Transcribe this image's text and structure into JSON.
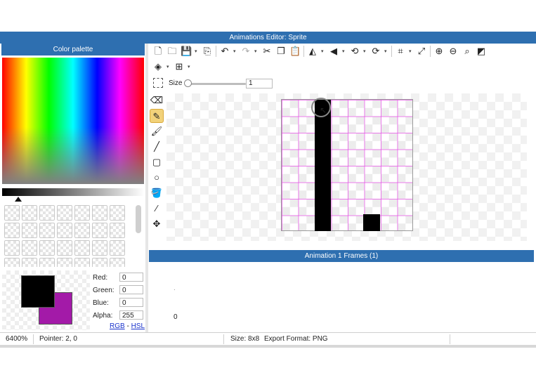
{
  "window": {
    "title": "Animations Editor: Sprite"
  },
  "palette": {
    "header": "Color palette",
    "foreground": "#000000",
    "background": "#a31aa8",
    "fields": [
      {
        "label": "Red:",
        "value": "0"
      },
      {
        "label": "Green:",
        "value": "0"
      },
      {
        "label": "Blue:",
        "value": "0"
      },
      {
        "label": "Alpha:",
        "value": "255"
      }
    ],
    "mode_rgb": "RGB",
    "mode_sep": "-",
    "mode_hsl": "HSL"
  },
  "toolbar": {
    "row1_icons": [
      "new-file",
      "open-folder",
      "save",
      "save-dropdown",
      "export",
      "undo",
      "undo-dropdown",
      "redo",
      "redo-dropdown",
      "cut",
      "copy",
      "paste",
      "flip-horizontal",
      "flip-dropdown",
      "flip-vertical",
      "flip-v-dropdown",
      "rotate-left",
      "rotate-left-dropdown",
      "rotate-right",
      "rotate-right-dropdown",
      "crop",
      "crop-dropdown",
      "resize",
      "zoom-in",
      "zoom-out",
      "zoom-fit",
      "actual-size"
    ],
    "row2_icons": [
      "layers",
      "layers-dropdown",
      "grid",
      "grid-dropdown"
    ],
    "size_label": "Size",
    "size_value": "1",
    "size_fraction": 0.0
  },
  "tools": [
    "select",
    "eraser",
    "pencil",
    "brush",
    "line",
    "rectangle",
    "ellipse",
    "fill",
    "eyedropper",
    "move"
  ],
  "active_tool": "pencil",
  "sprite": {
    "grid_cols": 8,
    "grid_rows": 8,
    "filled_pixels": [
      [
        2,
        0
      ],
      [
        2,
        1
      ],
      [
        2,
        2
      ],
      [
        2,
        3
      ],
      [
        2,
        4
      ],
      [
        2,
        5
      ],
      [
        2,
        6
      ],
      [
        2,
        7
      ],
      [
        5,
        7
      ]
    ]
  },
  "frames": {
    "header": "Animation 1 Frames (1)",
    "dot": ".",
    "index": "0"
  },
  "status": {
    "zoom": "6400%",
    "pointer": "Pointer: 2, 0",
    "size": "Size: 8x8",
    "format": "Export Format: PNG"
  }
}
